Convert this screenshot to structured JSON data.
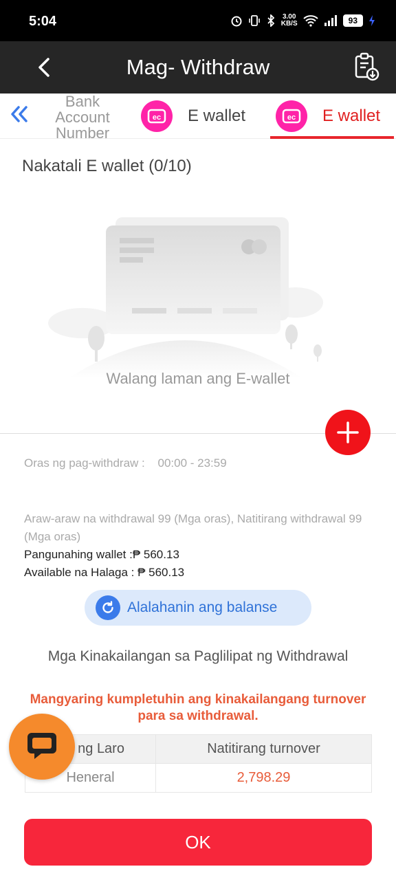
{
  "status_bar": {
    "time": "5:04",
    "net_speed_value": "3.00",
    "net_speed_unit": "KB/S",
    "battery": "93"
  },
  "header": {
    "title": "Mag- Withdraw"
  },
  "tabs": {
    "bank_label": "Bank Account Number",
    "ewallet_1_label": "E wallet",
    "ewallet_1_icon_text": "ec",
    "ewallet_2_label": "E wallet",
    "ewallet_2_icon_text": "ec"
  },
  "saved": {
    "label": "Nakatali E wallet (0/10)"
  },
  "empty_state": {
    "text": "Walang laman ang E-wallet"
  },
  "withdraw_info": {
    "hours_label": "Oras ng pag-withdraw :",
    "hours_value": "00:00 - 23:59",
    "daily_limit": "Araw-araw na withdrawal 99 (Mga oras), Natitirang withdrawal 99 (Mga oras)",
    "main_wallet": "Pangunahing wallet :₱ 560.13",
    "available": "Available na Halaga : ₱ 560.13"
  },
  "remember_button": {
    "label": "Alalahanin ang balanse"
  },
  "requirements": {
    "title": "Mga Kinakailangan sa Paglilipat ng Withdrawal",
    "warning": "Mangyaring kumpletuhin ang kinakailangang turnover para sa withdrawal.",
    "table": {
      "col1_header": "Uri ng Laro",
      "col2_header": "Natitirang turnover",
      "rows": [
        {
          "game": "Heneral",
          "turnover": "2,798.29"
        }
      ]
    }
  },
  "ok_button": {
    "label": "OK"
  },
  "colors": {
    "accent_red": "#f7263b",
    "tab_active": "#e8262c",
    "ewallet_pink": "#ff23a8",
    "chat_orange": "#f58a2c",
    "remember_blue": "#2f72d8"
  }
}
